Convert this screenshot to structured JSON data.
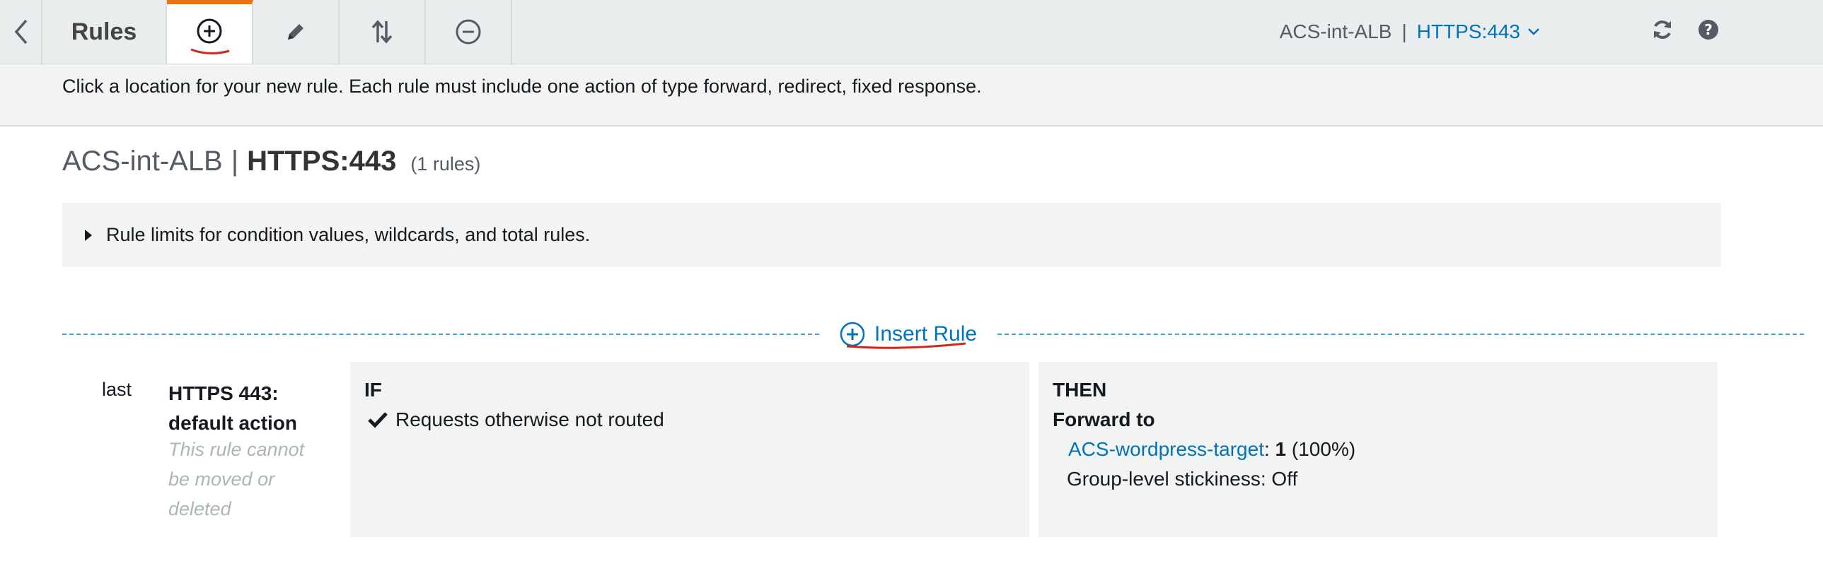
{
  "toolbar": {
    "title": "Rules",
    "tabs": [
      {
        "name": "add",
        "icon": "plus-circle-icon",
        "active": true
      },
      {
        "name": "edit",
        "icon": "pencil-icon",
        "active": false
      },
      {
        "name": "reorder",
        "icon": "sort-arrows-icon",
        "active": false
      },
      {
        "name": "delete",
        "icon": "minus-circle-icon",
        "active": false
      }
    ],
    "lb_name": "ACS-int-ALB",
    "separator": "|",
    "listener": "HTTPS:443",
    "icons": {
      "back": "chevron-left-icon",
      "refresh": "refresh-icon",
      "help": "help-icon",
      "dropdown": "chevron-down-icon"
    }
  },
  "banner": {
    "text": "Click a location for your new rule. Each rule must include one action of type forward, redirect, fixed response."
  },
  "heading": {
    "lb_name": "ACS-int-ALB",
    "separator": "|",
    "listener": "HTTPS:443",
    "rule_count": "(1 rules)"
  },
  "limits": {
    "text": "Rule limits for condition values, wildcards, and total rules."
  },
  "insert": {
    "label": "Insert Rule"
  },
  "rule": {
    "priority": "last",
    "name_line1": "HTTPS 443:",
    "name_line2": "default action",
    "note_line1": "This rule cannot",
    "note_line2": "be moved or",
    "note_line3": "deleted",
    "if_title": "IF",
    "condition": "Requests otherwise not routed",
    "then_title": "THEN",
    "action": "Forward to",
    "target_group": "ACS-wordpress-target",
    "target_sep": ":",
    "weight": "1",
    "weight_pct": "(100%)",
    "stickiness": "Group-level stickiness: Off"
  },
  "colors": {
    "accent_orange": "#ec7211",
    "link_blue": "#0073bb",
    "dash_blue": "#3b9fd6",
    "annotation_red": "#d0281c",
    "panel_gray": "#f2f3f3",
    "toolbar_gray": "#eaeded"
  }
}
